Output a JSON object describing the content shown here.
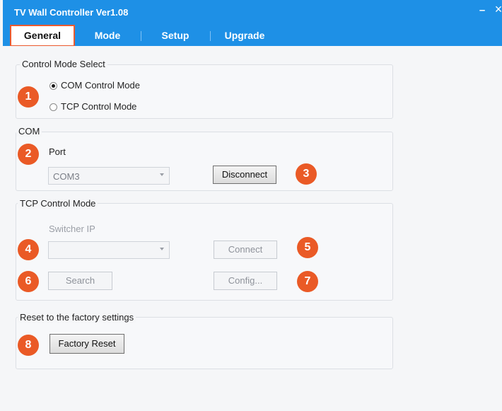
{
  "window": {
    "title": "TV Wall Controller Ver1.08",
    "minimize_glyph": "–",
    "close_glyph": "×"
  },
  "tabs": [
    {
      "label": "General",
      "active": true
    },
    {
      "label": "Mode",
      "active": false
    },
    {
      "label": "Setup",
      "active": false
    },
    {
      "label": "Upgrade",
      "active": false
    }
  ],
  "control_mode": {
    "title": "Control Mode Select",
    "options": [
      {
        "label": "COM Control Mode",
        "selected": true
      },
      {
        "label": "TCP Control Mode",
        "selected": false
      }
    ]
  },
  "com": {
    "title": "COM",
    "port_label": "Port",
    "port_value": "COM3",
    "disconnect_label": "Disconnect"
  },
  "tcp": {
    "title": "TCP Control Mode",
    "ip_label": "Switcher IP",
    "ip_value": "",
    "connect_label": "Connect",
    "search_label": "Search",
    "config_label": "Config..."
  },
  "reset": {
    "title": "Reset to the factory settings",
    "button_label": "Factory Reset"
  },
  "callouts": [
    "1",
    "2",
    "3",
    "4",
    "5",
    "6",
    "7",
    "8"
  ],
  "colors": {
    "titlebar": "#1e90e6",
    "callout": "#ea5a26",
    "active_tab_outline": "#ec5a2e",
    "background": "#f5f6f8"
  },
  "icons": {
    "combo_arrow": "chevron-down-icon"
  }
}
